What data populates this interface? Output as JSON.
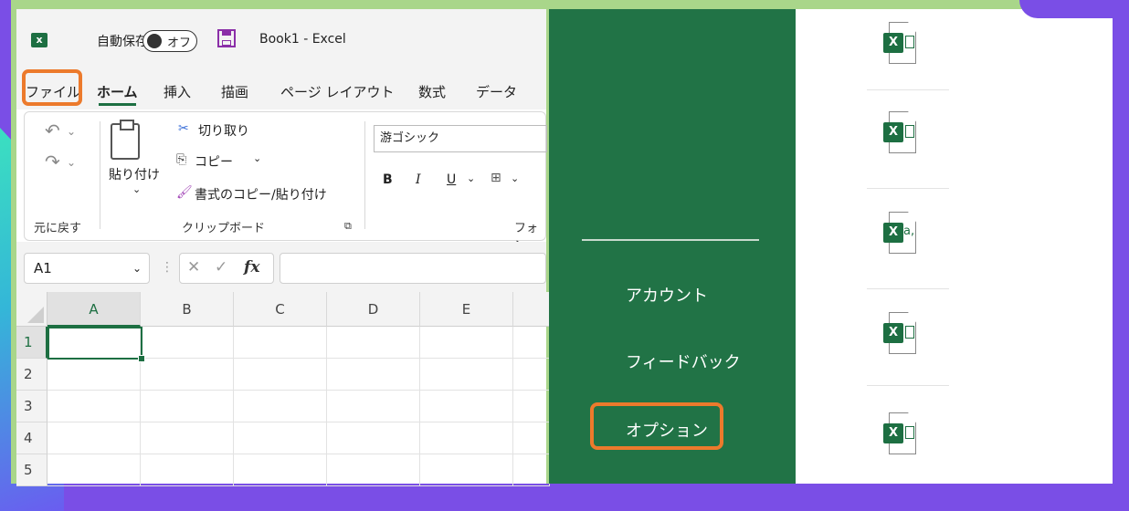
{
  "window": {
    "autosave_label": "自動保存",
    "autosave_state": "オフ",
    "document_title": "Book1  -  Excel"
  },
  "tabs": [
    "ファイル",
    "ホーム",
    "挿入",
    "描画",
    "ページ レイアウト",
    "数式",
    "データ"
  ],
  "active_tab": "ホーム",
  "ribbon": {
    "undo_group": "元に戻す",
    "paste_label": "貼り付け",
    "cut_label": "切り取り",
    "copy_label": "コピー",
    "format_painter_label": "書式のコピー/貼り付け",
    "clipboard_group": "クリップボード",
    "font_name": "游ゴシック",
    "bold": "B",
    "italic": "I",
    "underline": "U",
    "font_group": "フォン"
  },
  "formula_bar": {
    "name_box": "A1",
    "fx_label": "fx",
    "cancel": "✕",
    "enter": "✓"
  },
  "grid": {
    "columns": [
      "A",
      "B",
      "C",
      "D",
      "E"
    ],
    "rows": [
      "1",
      "2",
      "3",
      "4",
      "5"
    ],
    "active_cell": "A1"
  },
  "backstage": {
    "items": [
      "アカウント",
      "フィードバック",
      "オプション"
    ],
    "highlighted": "オプション"
  },
  "recent_files": [
    {
      "icon": "excel-workbook-icon"
    },
    {
      "icon": "excel-workbook-icon"
    },
    {
      "icon": "excel-addin-icon"
    },
    {
      "icon": "excel-workbook-icon"
    },
    {
      "icon": "excel-workbook-icon"
    }
  ],
  "colors": {
    "excel_green": "#217346",
    "highlight_orange": "#ec7a2c",
    "frame_green": "#a9d68a"
  }
}
